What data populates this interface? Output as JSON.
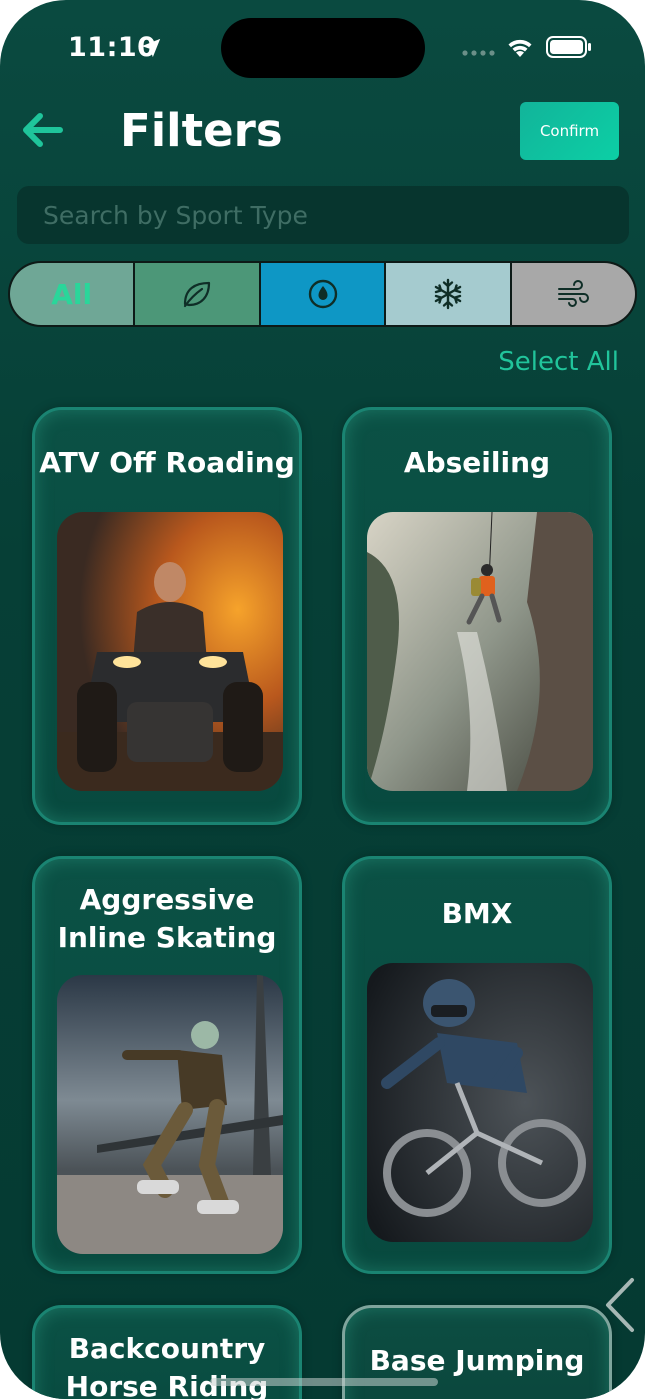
{
  "status_bar": {
    "time": "11:10"
  },
  "header": {
    "title": "Filters",
    "confirm_label": "Confirm"
  },
  "search": {
    "placeholder": "Search by Sport Type",
    "value": ""
  },
  "filter_segments": [
    {
      "label": "All",
      "icon": "all"
    },
    {
      "label": "",
      "icon": "leaf-icon"
    },
    {
      "label": "",
      "icon": "water-drop-icon"
    },
    {
      "label": "",
      "icon": "snowflake-icon"
    },
    {
      "label": "",
      "icon": "wind-icon"
    }
  ],
  "select_all_label": "Select All",
  "sports": [
    {
      "title": "ATV Off Roading"
    },
    {
      "title": "Abseiling"
    },
    {
      "title": "Aggressive\nInline Skating"
    },
    {
      "title": "BMX"
    },
    {
      "title": "Backcountry\nHorse Riding"
    },
    {
      "title": "Base Jumping"
    }
  ],
  "colors": {
    "background": "#063f36",
    "accent": "#21c49b",
    "confirm_button": "#0ccfa5"
  }
}
